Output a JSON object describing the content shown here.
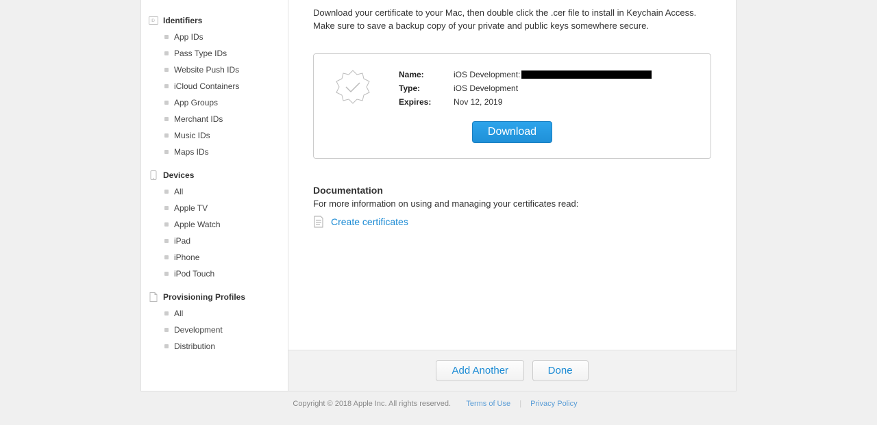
{
  "sidebar": {
    "sections": [
      {
        "title": "Identifiers",
        "items": [
          "App IDs",
          "Pass Type IDs",
          "Website Push IDs",
          "iCloud Containers",
          "App Groups",
          "Merchant IDs",
          "Music IDs",
          "Maps IDs"
        ]
      },
      {
        "title": "Devices",
        "items": [
          "All",
          "Apple TV",
          "Apple Watch",
          "iPad",
          "iPhone",
          "iPod Touch"
        ]
      },
      {
        "title": "Provisioning Profiles",
        "items": [
          "All",
          "Development",
          "Distribution"
        ]
      }
    ]
  },
  "main": {
    "description": "Download your certificate to your Mac, then double click the .cer file to install in Keychain Access. Make sure to save a backup copy of your private and public keys somewhere secure.",
    "cert": {
      "name_label": "Name:",
      "name_prefix": "iOS Development: ",
      "type_label": "Type:",
      "type_value": "iOS Development",
      "expires_label": "Expires:",
      "expires_value": "Nov 12, 2019",
      "download_label": "Download"
    },
    "documentation": {
      "heading": "Documentation",
      "desc": "For more information on using and managing your certificates read:",
      "link_label": "Create certificates"
    }
  },
  "actions": {
    "add_another": "Add Another",
    "done": "Done"
  },
  "footer": {
    "copyright": "Copyright © 2018 Apple Inc. All rights reserved.",
    "terms": "Terms of Use",
    "privacy": "Privacy Policy"
  }
}
